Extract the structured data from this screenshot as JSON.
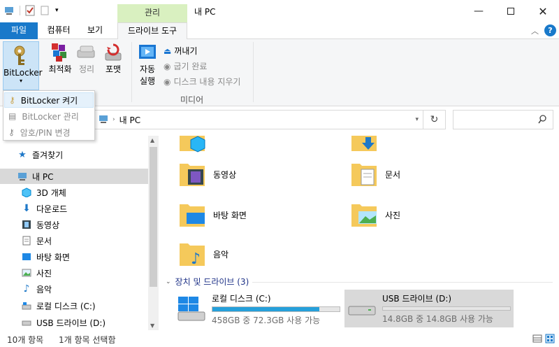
{
  "window": {
    "title": "내 PC",
    "context_tab": "관리",
    "controls": [
      "minimize",
      "maximize",
      "close"
    ]
  },
  "tabs": [
    {
      "label": "파일",
      "state": "file"
    },
    {
      "label": "컴퓨터",
      "state": "normal"
    },
    {
      "label": "보기",
      "state": "normal"
    },
    {
      "label": "드라이브 도구",
      "state": "active"
    }
  ],
  "ribbon": {
    "bitlocker_label": "BitLocker",
    "optimize_label": "최적화",
    "cleanup_label": "정리",
    "format_label": "포맷",
    "autoplay_label": "자동\n실행",
    "autoplay_line1": "자동",
    "autoplay_line2": "실행",
    "eject_label": "꺼내기",
    "finish_burn_label": "굽기 완료",
    "erase_disc_label": "디스크 내용 지우기",
    "media_group_label": "미디어"
  },
  "bitlocker_menu": [
    {
      "label": "BitLocker 켜기",
      "enabled": true
    },
    {
      "label": "BitLocker 관리",
      "enabled": false
    },
    {
      "label": "암호/PIN 변경",
      "enabled": false
    }
  ],
  "address": {
    "path": "내 PC",
    "search_placeholder": ""
  },
  "nav": [
    {
      "label": "즐겨찾기",
      "icon": "star-icon"
    },
    {
      "label": "내 PC",
      "icon": "pc-icon",
      "selected": true
    },
    {
      "label": "3D 개체",
      "icon": "3d-objects-icon"
    },
    {
      "label": "다운로드",
      "icon": "download-icon"
    },
    {
      "label": "동영상",
      "icon": "video-icon"
    },
    {
      "label": "문서",
      "icon": "document-icon"
    },
    {
      "label": "바탕 화면",
      "icon": "desktop-icon"
    },
    {
      "label": "사진",
      "icon": "pictures-icon"
    },
    {
      "label": "음악",
      "icon": "music-icon"
    },
    {
      "label": "로컬 디스크 (C:)",
      "icon": "local-disk-icon"
    },
    {
      "label": "USB 드라이브 (D:)",
      "icon": "usb-drive-icon"
    }
  ],
  "folders": [
    {
      "label": "동영상",
      "icon": "video-folder-icon"
    },
    {
      "label": "문서",
      "icon": "document-folder-icon"
    },
    {
      "label": "바탕 화면",
      "icon": "desktop-folder-icon"
    },
    {
      "label": "사진",
      "icon": "pictures-folder-icon"
    },
    {
      "label": "음악",
      "icon": "music-folder-icon"
    }
  ],
  "devices_section": "장치 및 드라이브 (3)",
  "drives": [
    {
      "name": "로컬 디스크 (C:)",
      "space": "458GB 중 72.3GB 사용 가능",
      "used_fraction": 0.84,
      "icon": "windows-drive-icon"
    },
    {
      "name": "USB 드라이브 (D:)",
      "space": "14.8GB 중 14.8GB 사용 가능",
      "used_fraction": 0.0,
      "icon": "usb-drive-icon",
      "selected": true
    }
  ],
  "status": {
    "count": "10개 항목",
    "selection": "1개 항목 선택함"
  },
  "colors": {
    "accent": "#1979ca",
    "context_tab": "#d9f0c0",
    "drive_bar": "#26a0da",
    "selection": "#d9d9d9"
  }
}
